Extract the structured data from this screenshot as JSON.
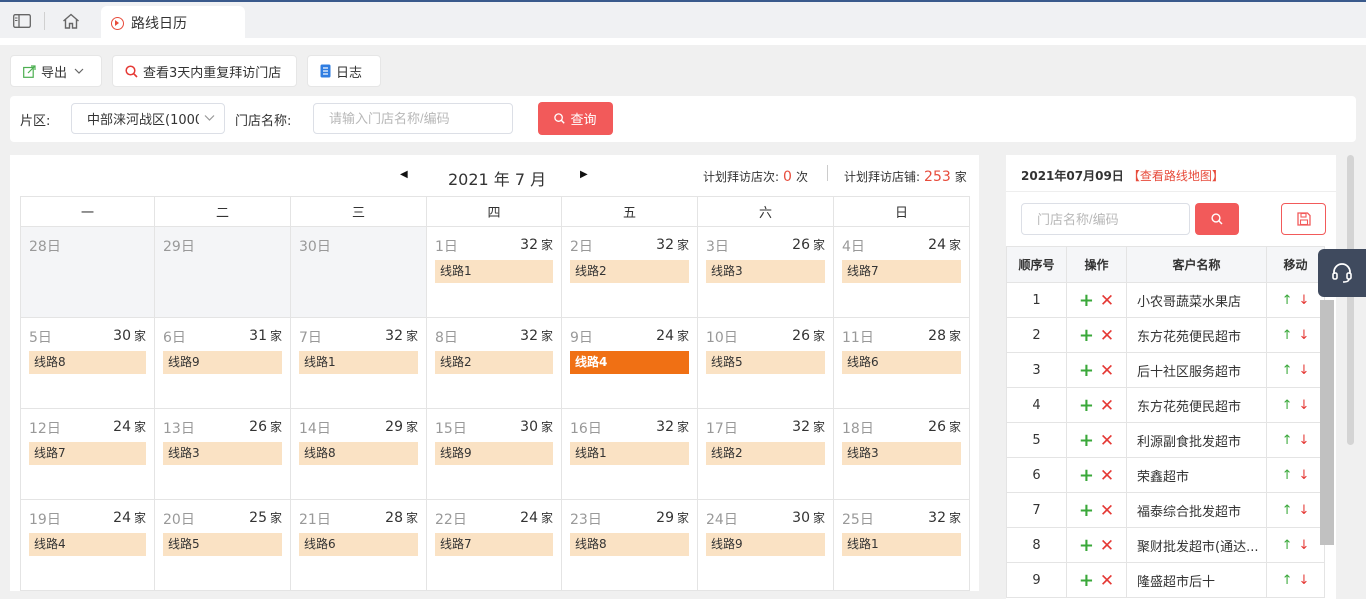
{
  "tabs": {
    "active_label": "路线日历"
  },
  "toolbar": {
    "export_label": "导出",
    "repeat_visit_label": "查看3天内重复拜访门店",
    "log_label": "日志"
  },
  "filter": {
    "area_label": "片区:",
    "area_value": "中部涞河战区(1000",
    "store_label": "门店名称:",
    "store_placeholder": "请输入门店名称/编码",
    "query_label": "查询"
  },
  "calendar": {
    "title": "2021 年 7 月",
    "plan_visits_label": "计划拜访店次:",
    "plan_visits_value": "0",
    "plan_visits_unit": "次",
    "plan_stores_label": "计划拜访店铺:",
    "plan_stores_value": "253",
    "plan_stores_unit": "家",
    "weekdays": [
      "一",
      "二",
      "三",
      "四",
      "五",
      "六",
      "日"
    ],
    "unit": "家",
    "weeks": [
      [
        {
          "day": "28日",
          "other": true
        },
        {
          "day": "29日",
          "other": true
        },
        {
          "day": "30日",
          "other": true
        },
        {
          "day": "1日",
          "count": "32",
          "route": "线路1"
        },
        {
          "day": "2日",
          "count": "32",
          "route": "线路2"
        },
        {
          "day": "3日",
          "count": "26",
          "route": "线路3"
        },
        {
          "day": "4日",
          "count": "24",
          "route": "线路7"
        }
      ],
      [
        {
          "day": "5日",
          "count": "30",
          "route": "线路8"
        },
        {
          "day": "6日",
          "count": "31",
          "route": "线路9"
        },
        {
          "day": "7日",
          "count": "32",
          "route": "线路1"
        },
        {
          "day": "8日",
          "count": "32",
          "route": "线路2"
        },
        {
          "day": "9日",
          "count": "24",
          "route": "线路4",
          "selected": true
        },
        {
          "day": "10日",
          "count": "26",
          "route": "线路5"
        },
        {
          "day": "11日",
          "count": "28",
          "route": "线路6"
        }
      ],
      [
        {
          "day": "12日",
          "count": "24",
          "route": "线路7"
        },
        {
          "day": "13日",
          "count": "26",
          "route": "线路3"
        },
        {
          "day": "14日",
          "count": "29",
          "route": "线路8"
        },
        {
          "day": "15日",
          "count": "30",
          "route": "线路9"
        },
        {
          "day": "16日",
          "count": "32",
          "route": "线路1"
        },
        {
          "day": "17日",
          "count": "32",
          "route": "线路2"
        },
        {
          "day": "18日",
          "count": "26",
          "route": "线路3"
        }
      ],
      [
        {
          "day": "19日",
          "count": "24",
          "route": "线路4"
        },
        {
          "day": "20日",
          "count": "25",
          "route": "线路5"
        },
        {
          "day": "21日",
          "count": "28",
          "route": "线路6"
        },
        {
          "day": "22日",
          "count": "24",
          "route": "线路7"
        },
        {
          "day": "23日",
          "count": "29",
          "route": "线路8"
        },
        {
          "day": "24日",
          "count": "30",
          "route": "线路9"
        },
        {
          "day": "25日",
          "count": "32",
          "route": "线路1"
        }
      ]
    ]
  },
  "detail": {
    "date": "2021年07月09日",
    "map_link": "【查看路线地图】",
    "search_placeholder": "门店名称/编码",
    "columns": [
      "顺序号",
      "操作",
      "客户名称",
      "移动"
    ],
    "op_plus": "+",
    "op_remove": "✕",
    "move_up": "↑",
    "move_down": "↓",
    "rows": [
      {
        "no": "1",
        "name": "小农哥蔬菜水果店"
      },
      {
        "no": "2",
        "name": "东方花苑便民超市"
      },
      {
        "no": "3",
        "name": "后十社区服务超市"
      },
      {
        "no": "4",
        "name": "东方花苑便民超市"
      },
      {
        "no": "5",
        "name": "利源副食批发超市"
      },
      {
        "no": "6",
        "name": "荣鑫超市"
      },
      {
        "no": "7",
        "name": "福泰综合批发超市"
      },
      {
        "no": "8",
        "name": "聚财批发超市(通达..."
      },
      {
        "no": "9",
        "name": "隆盛超市后十"
      }
    ]
  },
  "colors": {
    "accent": "#f25a5a",
    "route_bg": "#fae2c4",
    "route_selected": "#f07014",
    "stat_number": "#e74c3c"
  },
  "icons": [
    "sidebar-toggle-icon",
    "home-icon",
    "tab-route-icon",
    "export-icon",
    "chevron-down-icon",
    "search-icon",
    "log-icon",
    "save-icon",
    "headset-icon"
  ]
}
